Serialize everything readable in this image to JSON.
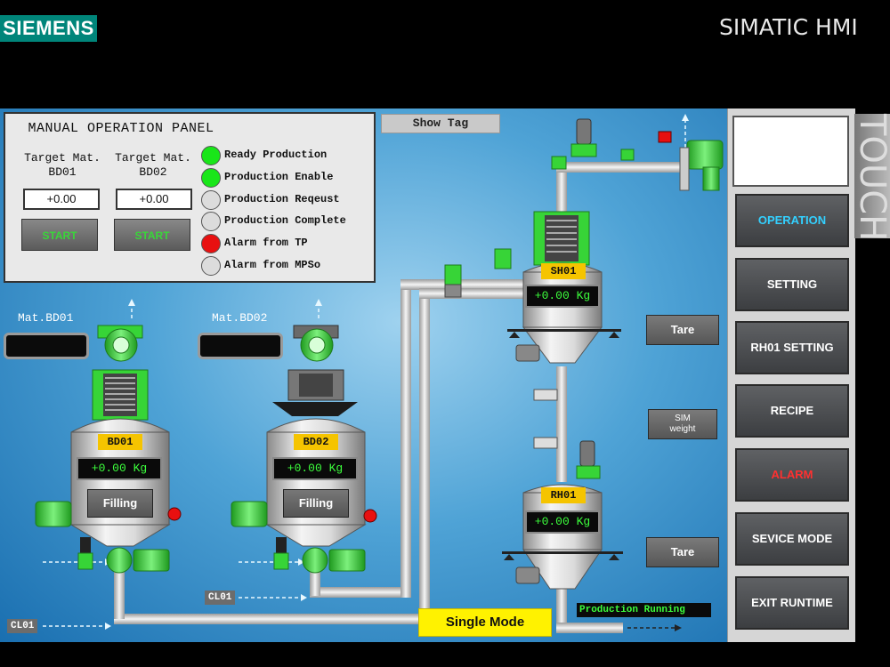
{
  "header": {
    "logo_text": "SIEMENS",
    "title": "SIMATIC HMI",
    "side_label": "TOUCH"
  },
  "manual_panel": {
    "title": "MANUAL OPERATION PANEL",
    "target_bd01_label_1": "Target Mat.",
    "target_bd01_label_2": "BD01",
    "target_bd02_label_1": "Target Mat.",
    "target_bd02_label_2": "BD02",
    "target_bd01_value": "+0.00",
    "target_bd02_value": "+0.00",
    "start_bd01_label": "START",
    "start_bd02_label": "START",
    "status": [
      {
        "label": "Ready Production",
        "state": "green"
      },
      {
        "label": "Production Enable",
        "state": "green"
      },
      {
        "label": "Production Reqeust",
        "state": "off"
      },
      {
        "label": "Production Complete",
        "state": "off"
      },
      {
        "label": "Alarm from TP",
        "state": "red"
      },
      {
        "label": "Alarm from MPSo",
        "state": "off"
      }
    ]
  },
  "show_tag_label": "Show Tag",
  "materials": {
    "mat_bd01_label": "Mat.BD01",
    "mat_bd02_label": "Mat.BD02"
  },
  "vessels": {
    "bd01": {
      "tag": "BD01",
      "weight": "+0.00 Kg",
      "button": "Filling"
    },
    "bd02": {
      "tag": "BD02",
      "weight": "+0.00 Kg",
      "button": "Filling"
    },
    "sh01": {
      "tag": "SH01",
      "weight": "+0.00 Kg"
    },
    "rh01": {
      "tag": "RH01",
      "weight": "+0.00 Kg"
    }
  },
  "buttons": {
    "tare_sh01": "Tare",
    "sim_weight_1": "SIM",
    "sim_weight_2": "weight",
    "tare_rh01": "Tare"
  },
  "lines": {
    "cl01_upper": "CL01",
    "cl01_lower": "CL01"
  },
  "mode": {
    "single_mode": "Single Mode",
    "production_status": "Production Running"
  },
  "nav": [
    {
      "label": "OPERATION",
      "color": "#33d0ff"
    },
    {
      "label": "SETTING",
      "color": "#ffffff"
    },
    {
      "label": "RH01 SETTING",
      "color": "#ffffff"
    },
    {
      "label": "RECIPE",
      "color": "#ffffff"
    },
    {
      "label": "ALARM",
      "color": "#ff3030"
    },
    {
      "label": "SEVICE MODE",
      "color": "#ffffff"
    },
    {
      "label": "EXIT RUNTIME",
      "color": "#ffffff"
    }
  ],
  "colors": {
    "brand": "#00857a",
    "led_green": "#19e619",
    "led_red": "#e81010",
    "led_off": "#dcdcdc",
    "equipment_green": "#37d437",
    "readout_text": "#3cff3c",
    "tag_yellow": "#f5c400"
  }
}
